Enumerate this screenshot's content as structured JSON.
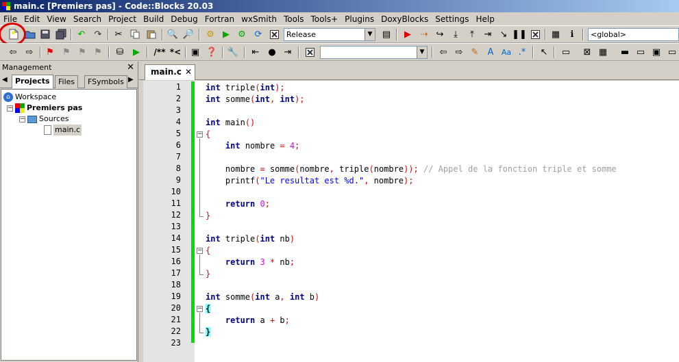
{
  "window": {
    "title": "main.c [Premiers pas] - Code::Blocks 20.03"
  },
  "menu": [
    "File",
    "Edit",
    "View",
    "Search",
    "Project",
    "Build",
    "Debug",
    "Fortran",
    "wxSmith",
    "Tools",
    "Tools+",
    "Plugins",
    "DoxyBlocks",
    "Settings",
    "Help"
  ],
  "toolbar": {
    "build_target": "Release",
    "scope": "<global>",
    "doxy_comment": "/**",
    "doxy_inline": "*<",
    "symbol_combo": ""
  },
  "management": {
    "title": "Management",
    "tabs": [
      "Projects",
      "Files",
      "FSymbols"
    ],
    "tree": {
      "workspace": "Workspace",
      "project": "Premiers pas",
      "folder": "Sources",
      "file": "main.c"
    }
  },
  "editor": {
    "tab": "main.c",
    "line_numbers": [
      "1",
      "2",
      "3",
      "4",
      "5",
      "6",
      "7",
      "8",
      "9",
      "10",
      "11",
      "12",
      "13",
      "14",
      "15",
      "16",
      "17",
      "18",
      "19",
      "20",
      "21",
      "22",
      "23"
    ]
  },
  "colors": {
    "keyword": "#00008b",
    "number": "#e000e0",
    "operator": "#e00000",
    "string": "#0000ff",
    "comment": "#a0a0a0",
    "change_bar": "#00e000"
  }
}
